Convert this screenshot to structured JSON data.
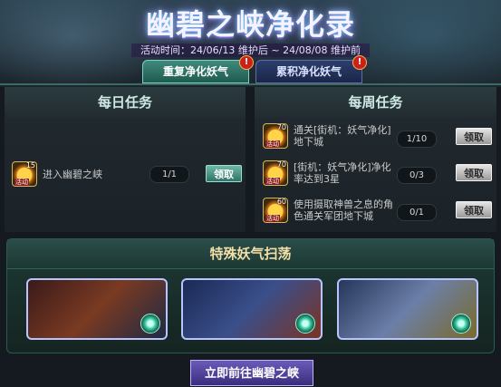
{
  "header": {
    "title": "幽碧之峡净化录",
    "time_text": "活动时间：24/06/13 维护后 ~ 24/08/08 维护前"
  },
  "tabs": [
    {
      "label": "重复净化妖气",
      "badge": "!"
    },
    {
      "label": "累积净化妖气",
      "badge": "!"
    }
  ],
  "daily": {
    "title": "每日任务",
    "quests": [
      {
        "token_num": "15",
        "token_tag": "活动",
        "text": "进入幽碧之峡",
        "progress": "1/1",
        "button": "领取",
        "button_style": "active"
      }
    ]
  },
  "weekly": {
    "title": "每周任务",
    "quests": [
      {
        "token_num": "70",
        "token_tag": "活动",
        "text": "通关[街机：妖气净化]地下城",
        "progress": "1/10",
        "button": "领取",
        "button_style": "disabled"
      },
      {
        "token_num": "70",
        "token_tag": "活动",
        "text": "[街机：妖气净化]净化率达到3星",
        "progress": "0/3",
        "button": "领取",
        "button_style": "disabled"
      },
      {
        "token_num": "60",
        "token_tag": "活动",
        "text": "使用摄取神兽之息的角色通关军团地下城",
        "progress": "0/1",
        "button": "领取",
        "button_style": "disabled"
      }
    ]
  },
  "special": {
    "title": "特殊妖气扫荡",
    "cards": [
      {
        "name": "sweep-card-1",
        "colors": [
          "#3a1a1a",
          "#7a3a22",
          "#1f2a44"
        ]
      },
      {
        "name": "sweep-card-2",
        "colors": [
          "#1a2a55",
          "#3b4f8a",
          "#7a3322"
        ]
      },
      {
        "name": "sweep-card-3",
        "colors": [
          "#26365a",
          "#6c7fa8",
          "#7a6a2a"
        ]
      }
    ]
  },
  "go_button": "立即前往幽碧之峡",
  "colors": {
    "active_tab": "#3f8a7c",
    "inactive_tab": "#2d3e6c",
    "accent": "#f3dfa8"
  }
}
